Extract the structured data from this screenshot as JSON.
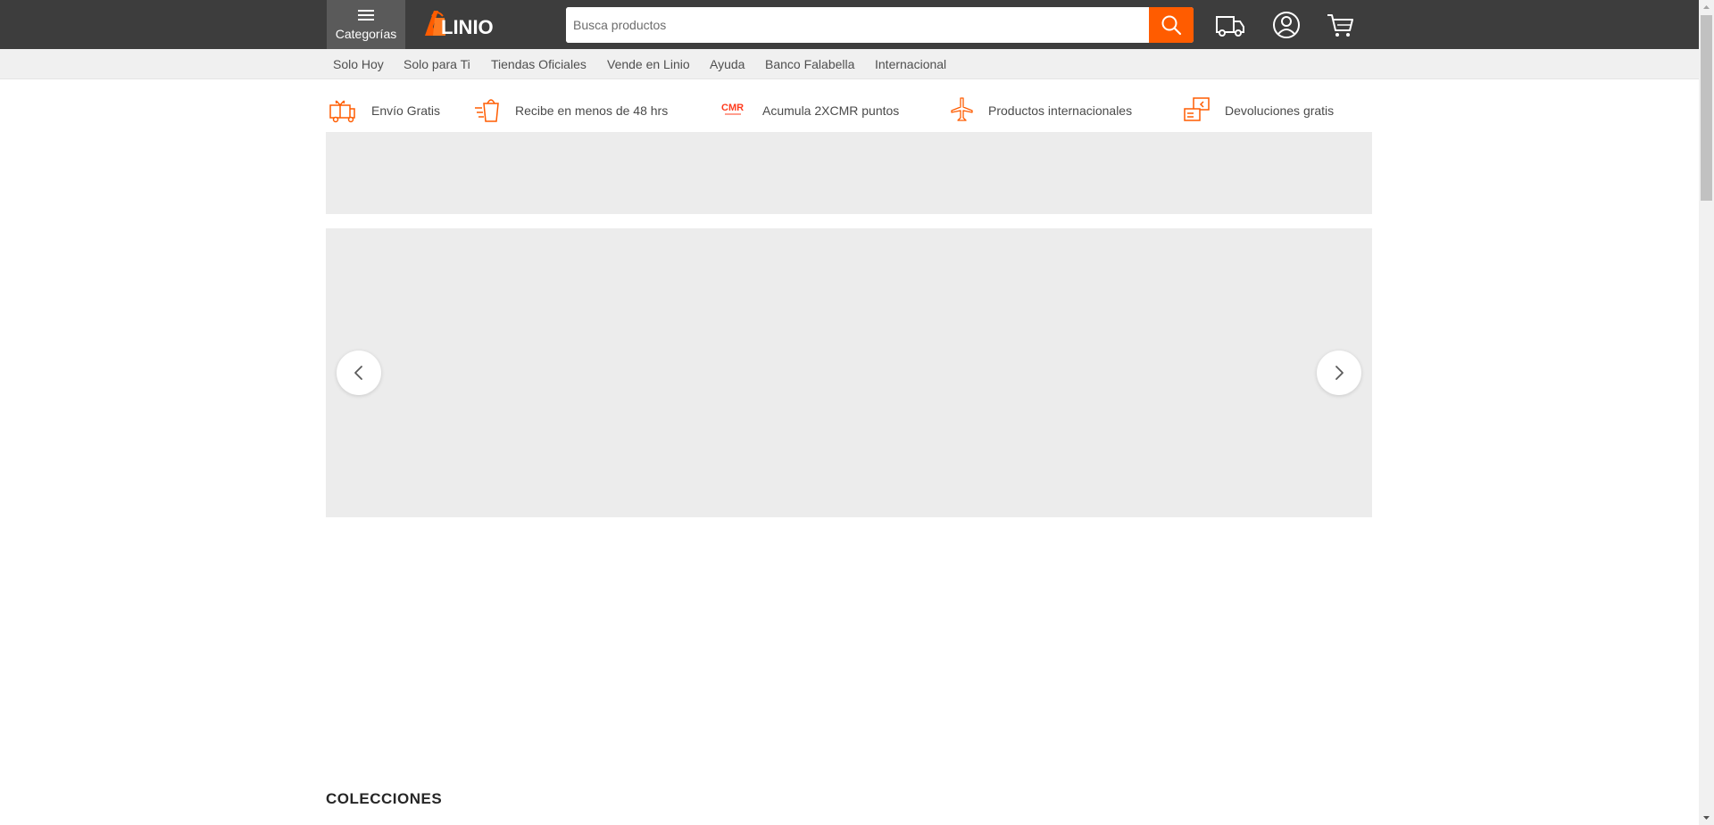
{
  "header": {
    "categories_label": "Categorías",
    "logo_text": "LINIO",
    "search_placeholder": "Busca productos",
    "brand_color": "#ff5c00",
    "icons": [
      "truck-icon",
      "user-icon",
      "cart-icon"
    ]
  },
  "subnav": {
    "items": [
      "Solo Hoy",
      "Solo para Ti",
      "Tiendas Oficiales",
      "Vende en Linio",
      "Ayuda",
      "Banco Falabella",
      "Internacional"
    ]
  },
  "benefits": [
    {
      "label": "Envío Gratis",
      "icon": "gift-truck-icon"
    },
    {
      "label": "Recibe en menos de 48 hrs",
      "icon": "fast-bag-icon"
    },
    {
      "label": "Acumula 2XCMR puntos",
      "icon": "cmr-logo-icon",
      "icon_text": "CMR"
    },
    {
      "label": "Productos internacionales",
      "icon": "airplane-icon"
    },
    {
      "label": "Devoluciones gratis",
      "icon": "return-box-icon"
    }
  ],
  "sections": {
    "collections_title": "COLECCIONES"
  }
}
